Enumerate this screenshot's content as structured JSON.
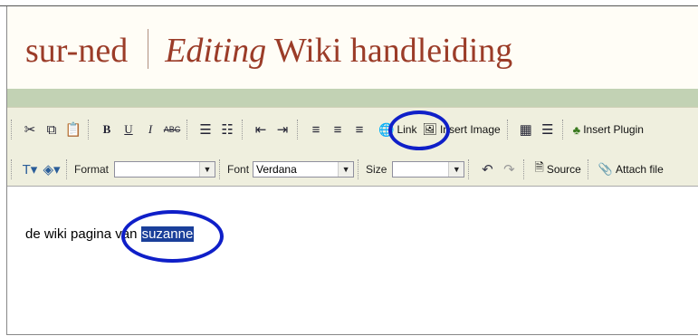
{
  "header": {
    "site": "sur-ned",
    "title_italic": "Editing",
    "title_rest": "Wiki handleiding"
  },
  "toolbar": {
    "row1": {
      "link_label": "Link",
      "insert_image_label": "Insert Image",
      "insert_plugin_label": "Insert Plugin"
    },
    "row2": {
      "format_label": "Format",
      "format_value": "",
      "font_label": "Font",
      "font_value": "Verdana",
      "size_label": "Size",
      "size_value": "",
      "source_label": "Source",
      "attach_label": "Attach file"
    }
  },
  "editor": {
    "text_before": "de wiki pagina van ",
    "selected_text": "suzanne"
  },
  "colors": {
    "title": "#9b3c28",
    "annotation_ring": "#0f1fc8",
    "selection": "#1a3f9a",
    "toolbar_bg": "#efefde",
    "green_bar": "#c2d2b4"
  }
}
